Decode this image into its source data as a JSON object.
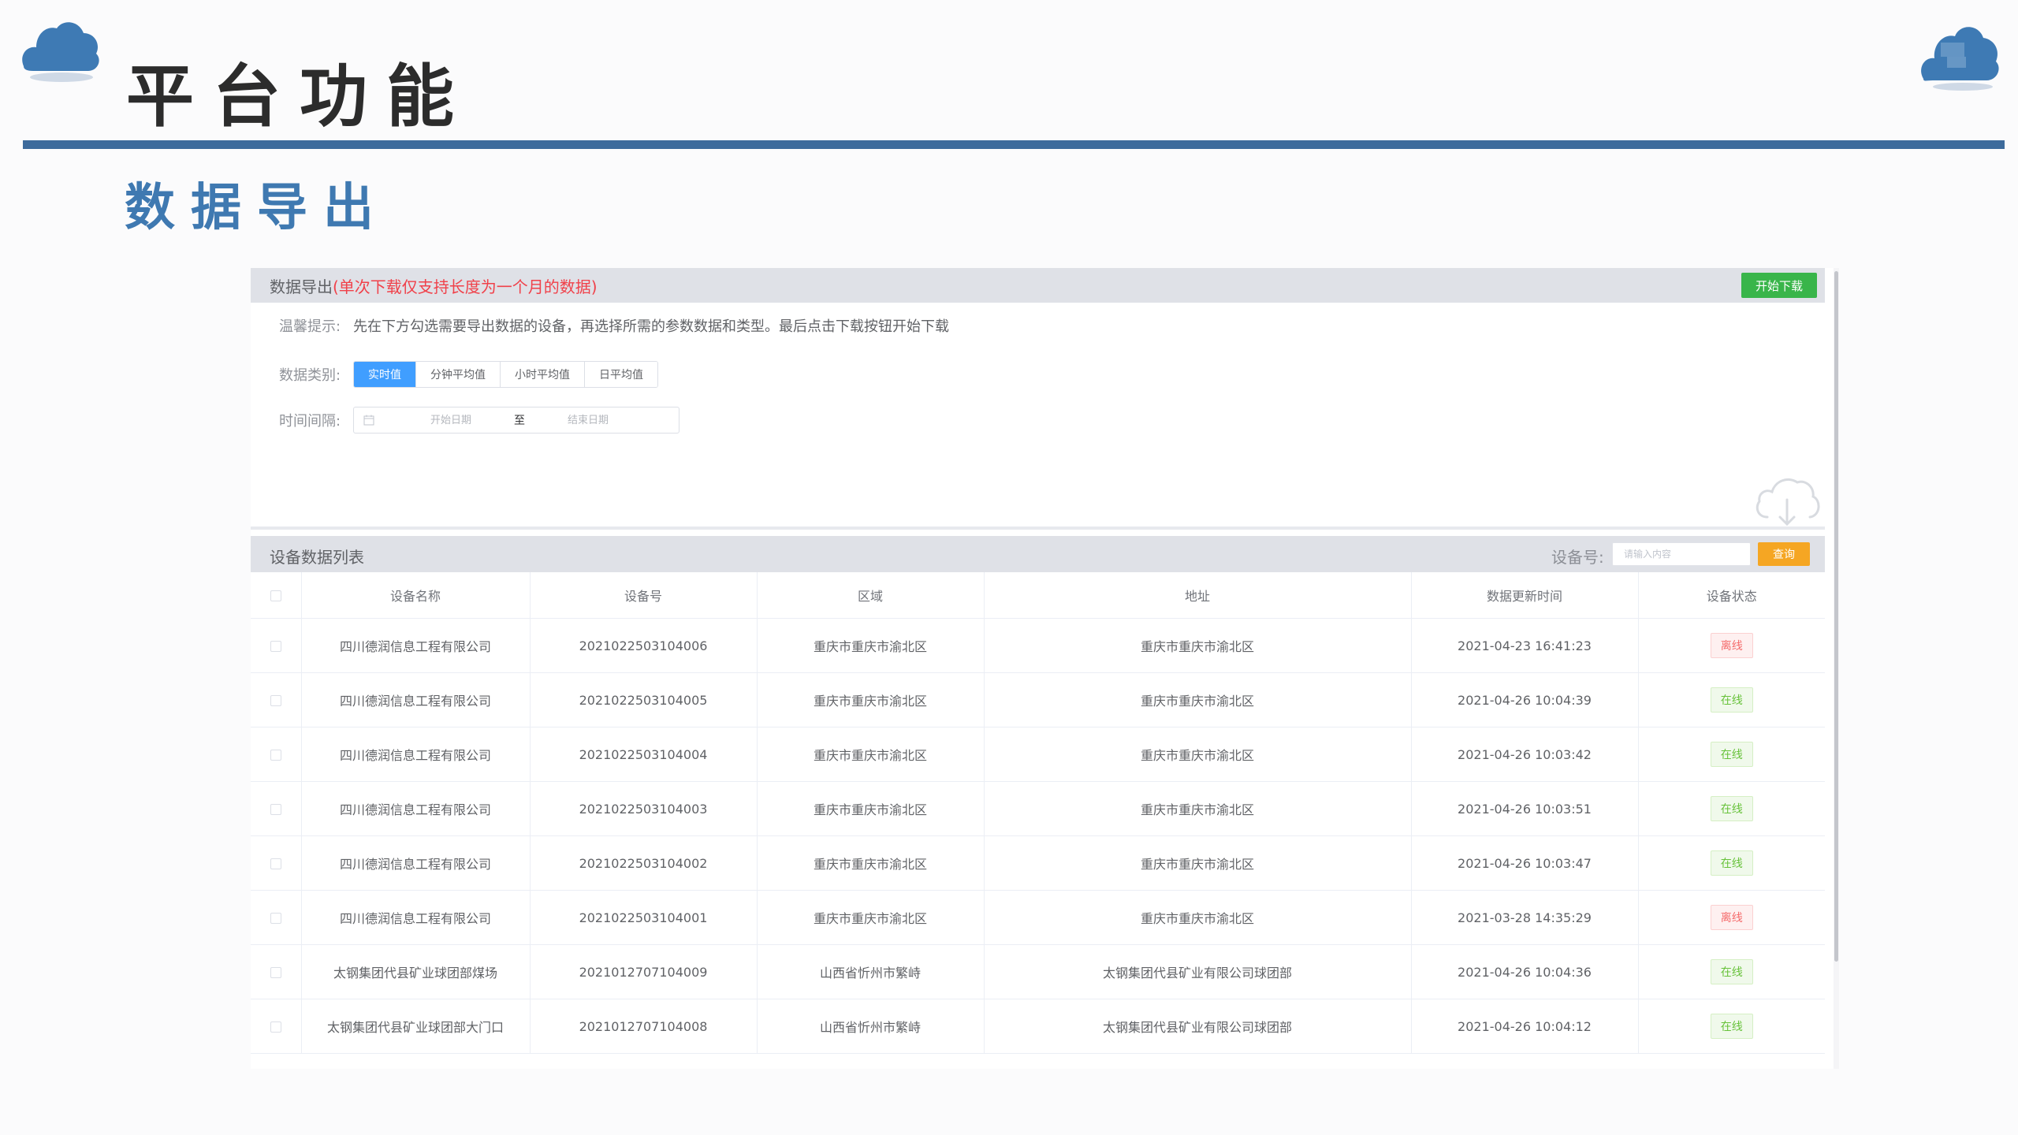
{
  "page": {
    "title": "平台功能",
    "subtitle": "数据导出",
    "accent_color": "#3d6b9c"
  },
  "export_panel": {
    "title": "数据导出",
    "note": "(单次下载仅支持长度为一个月的数据)",
    "download_button": "开始下载",
    "tip_label": "温馨提示:",
    "tip_text": "先在下方勾选需要导出数据的设备，再选择所需的参数数据和类型。最后点击下载按钮开始下载",
    "category_label": "数据类别:",
    "categories": [
      "实时值",
      "分钟平均值",
      "小时平均值",
      "日平均值"
    ],
    "selected_category": "实时值",
    "time_label": "时间间隔:",
    "start_placeholder": "开始日期",
    "range_separator": "至",
    "end_placeholder": "结束日期"
  },
  "device_list": {
    "title": "设备数据列表",
    "search_label": "设备号:",
    "search_placeholder": "请输入内容",
    "query_button": "查询",
    "columns": [
      "设备名称",
      "设备号",
      "区域",
      "地址",
      "数据更新时间",
      "设备状态"
    ],
    "rows": [
      {
        "name": "四川德润信息工程有限公司",
        "id": "2021022503104006",
        "region": "重庆市重庆市渝北区",
        "address": "重庆市重庆市渝北区",
        "updated": "2021-04-23 16:41:23",
        "status": "离线",
        "online": false
      },
      {
        "name": "四川德润信息工程有限公司",
        "id": "2021022503104005",
        "region": "重庆市重庆市渝北区",
        "address": "重庆市重庆市渝北区",
        "updated": "2021-04-26 10:04:39",
        "status": "在线",
        "online": true
      },
      {
        "name": "四川德润信息工程有限公司",
        "id": "2021022503104004",
        "region": "重庆市重庆市渝北区",
        "address": "重庆市重庆市渝北区",
        "updated": "2021-04-26 10:03:42",
        "status": "在线",
        "online": true
      },
      {
        "name": "四川德润信息工程有限公司",
        "id": "2021022503104003",
        "region": "重庆市重庆市渝北区",
        "address": "重庆市重庆市渝北区",
        "updated": "2021-04-26 10:03:51",
        "status": "在线",
        "online": true
      },
      {
        "name": "四川德润信息工程有限公司",
        "id": "2021022503104002",
        "region": "重庆市重庆市渝北区",
        "address": "重庆市重庆市渝北区",
        "updated": "2021-04-26 10:03:47",
        "status": "在线",
        "online": true
      },
      {
        "name": "四川德润信息工程有限公司",
        "id": "2021022503104001",
        "region": "重庆市重庆市渝北区",
        "address": "重庆市重庆市渝北区",
        "updated": "2021-03-28 14:35:29",
        "status": "离线",
        "online": false
      },
      {
        "name": "太钢集团代县矿业球团部煤场",
        "id": "2021012707104009",
        "region": "山西省忻州市繁峙",
        "address": "太钢集团代县矿业有限公司球团部",
        "updated": "2021-04-26 10:04:36",
        "status": "在线",
        "online": true
      },
      {
        "name": "太钢集团代县矿业球团部大门口",
        "id": "2021012707104008",
        "region": "山西省忻州市繁峙",
        "address": "太钢集团代县矿业有限公司球团部",
        "updated": "2021-04-26 10:04:12",
        "status": "在线",
        "online": true
      }
    ]
  }
}
